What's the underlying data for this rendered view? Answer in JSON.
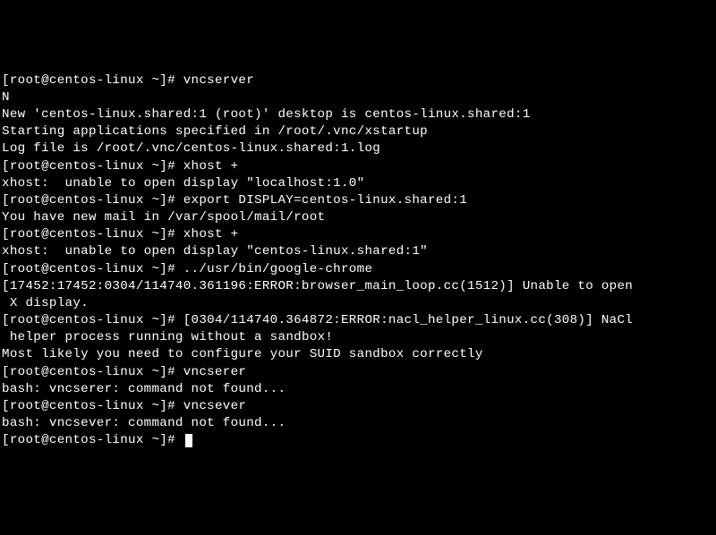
{
  "terminal": {
    "lines": [
      "[root@centos-linux ~]# vncserver",
      "N",
      "New 'centos-linux.shared:1 (root)' desktop is centos-linux.shared:1",
      "",
      "Starting applications specified in /root/.vnc/xstartup",
      "Log file is /root/.vnc/centos-linux.shared:1.log",
      "",
      "[root@centos-linux ~]# xhost +",
      "xhost:  unable to open display \"localhost:1.0\"",
      "[root@centos-linux ~]# export DISPLAY=centos-linux.shared:1",
      "You have new mail in /var/spool/mail/root",
      "[root@centos-linux ~]# xhost +",
      "xhost:  unable to open display \"centos-linux.shared:1\"",
      "[root@centos-linux ~]# ../usr/bin/google-chrome",
      "[17452:17452:0304/114740.361196:ERROR:browser_main_loop.cc(1512)] Unable to open",
      " X display.",
      "[root@centos-linux ~]# [0304/114740.364872:ERROR:nacl_helper_linux.cc(308)] NaCl",
      " helper process running without a sandbox!",
      "Most likely you need to configure your SUID sandbox correctly",
      "",
      "[root@centos-linux ~]# vncserer",
      "bash: vncserer: command not found...",
      "[root@centos-linux ~]# vncsever",
      "bash: vncsever: command not found...",
      "[root@centos-linux ~]# "
    ]
  }
}
